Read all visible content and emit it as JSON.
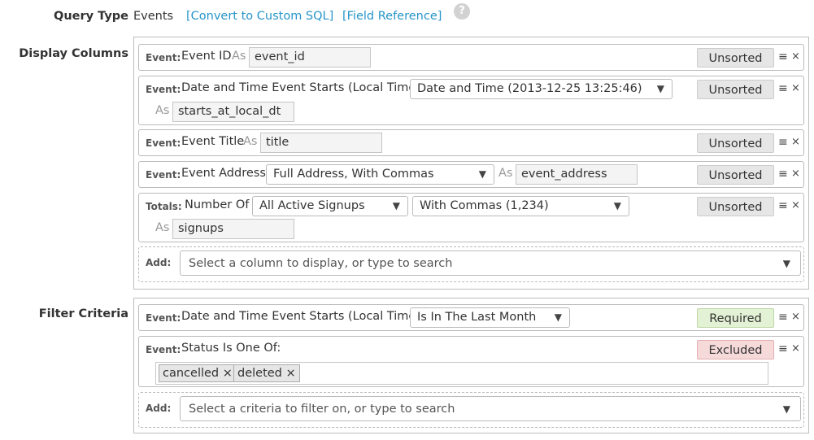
{
  "query_type": {
    "label": "Query Type",
    "value": "Events",
    "convert_link": "[Convert to Custom SQL]",
    "field_ref_link": "[Field Reference]",
    "help_glyph": "?"
  },
  "display_columns": {
    "label": "Display Columns",
    "rows": [
      {
        "tag": "Event:",
        "field": "Event ID",
        "as": "As",
        "alias": "event_id",
        "sort": "Unsorted"
      },
      {
        "tag": "Event:",
        "field": "Date and Time Event Starts (Local Time)",
        "format": "Date and Time (2013-12-25 13:25:46)",
        "as": "As",
        "alias": "starts_at_local_dt",
        "sort": "Unsorted"
      },
      {
        "tag": "Event:",
        "field": "Event Title",
        "as": "As",
        "alias": "title",
        "sort": "Unsorted"
      },
      {
        "tag": "Event:",
        "field": "Event Address",
        "format": "Full Address, With Commas",
        "as": "As",
        "alias": "event_address",
        "sort": "Unsorted"
      },
      {
        "tag": "Totals:",
        "field": "Number Of",
        "select1": "All Active Signups",
        "select2": "With Commas (1,234)",
        "as": "As",
        "alias": "signups",
        "sort": "Unsorted"
      }
    ],
    "add_label": "Add:",
    "add_placeholder": "Select a column to display, or type to search"
  },
  "filter_criteria": {
    "label": "Filter Criteria",
    "rows": [
      {
        "tag": "Event:",
        "field": "Date and Time Event Starts (Local Time)",
        "condition": "Is In The Last Month",
        "status": "Required"
      },
      {
        "tag": "Event:",
        "field": "Status Is One Of:",
        "values": [
          "cancelled",
          "deleted"
        ],
        "status": "Excluded"
      }
    ],
    "add_label": "Add:",
    "add_placeholder": "Select a criteria to filter on, or type to search"
  },
  "glyphs": {
    "menu": "≡",
    "remove": "×",
    "dropdown": "▼",
    "chip_remove": "×"
  },
  "icons": {
    "menu": "drag-menu-icon",
    "remove": "remove-icon",
    "dropdown": "dropdown-arrow-icon",
    "help": "help-icon"
  },
  "colors": {
    "link": "#2795c9",
    "required_bg": "#e3f1d4",
    "excluded_bg": "#f6d9d9",
    "sort_bg": "#e6e6e6"
  }
}
